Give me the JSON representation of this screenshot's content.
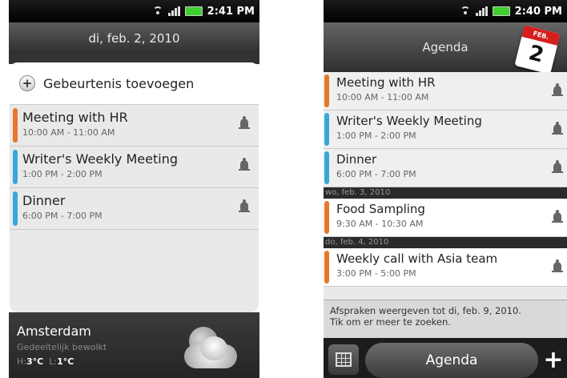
{
  "left_screen": {
    "status": {
      "time": "2:41 PM"
    },
    "date_header": "di, feb. 2, 2010",
    "add_event_label": "Gebeurtenis toevoegen",
    "events": [
      {
        "title": "Meeting with HR",
        "time": "10:00 AM - 11:00 AM",
        "color": "#e8762a"
      },
      {
        "title": "Writer's Weekly Meeting",
        "time": "1:00 PM - 2:00 PM",
        "color": "#36a8d8"
      },
      {
        "title": "Dinner",
        "time": "6:00 PM - 7:00 PM",
        "color": "#36a8d8"
      }
    ],
    "weather": {
      "city": "Amsterdam",
      "condition": "Gedeeltelijk bewolkt",
      "high_label": "H:",
      "high": "3°C",
      "low_label": "L:",
      "low": "1°C",
      "icon": "partly-cloudy-night-icon"
    }
  },
  "right_screen": {
    "status": {
      "time": "2:40 PM"
    },
    "header_title": "Agenda",
    "calendar_icon": {
      "month": "FEB.",
      "day": "2"
    },
    "events_today": [
      {
        "title": "Meeting with HR",
        "time": "10:00 AM - 11:00 AM",
        "color": "#e8762a"
      },
      {
        "title": "Writer's Weekly Meeting",
        "time": "1:00 PM - 2:00 PM",
        "color": "#36a8d8"
      },
      {
        "title": "Dinner",
        "time": "6:00 PM - 7:00 PM",
        "color": "#36a8d8"
      }
    ],
    "day2_label": "wo, feb. 3, 2010",
    "day2_events": [
      {
        "title": "Food Sampling",
        "time": "9:30 AM - 10:30 AM",
        "color": "#e8762a"
      }
    ],
    "day3_label": "do, feb. 4, 2010",
    "day3_events": [
      {
        "title": "Weekly call with Asia team",
        "time": "3:00 PM - 5:00 PM",
        "color": "#e8762a"
      }
    ],
    "footer_note_line1": "Afspraken weergeven tot di, feb. 9, 2010.",
    "footer_note_line2": "Tik om er meer te zoeken.",
    "bottom_bar": {
      "agenda_label": "Agenda",
      "plus_label": "+"
    }
  }
}
